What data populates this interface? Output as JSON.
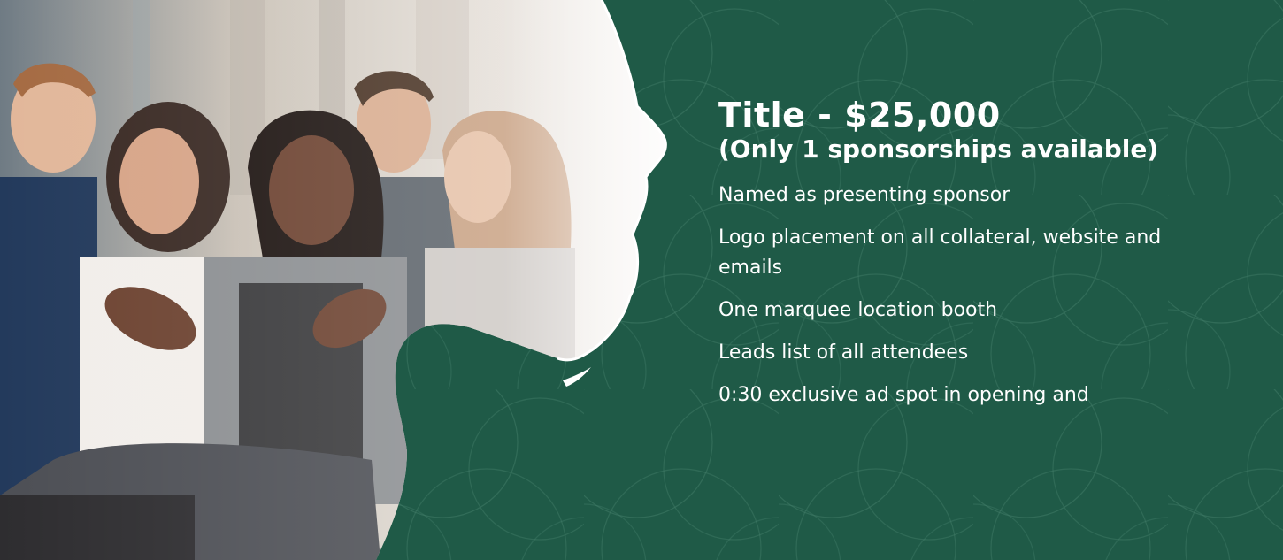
{
  "sponsorship": {
    "title": "Title - $25,000",
    "subtitle": "(Only 1 sponsorships available)",
    "benefits": [
      "Named as presenting sponsor",
      "Logo placement on all collateral, website and emails",
      "One marquee location booth",
      "Leads list of all attendees",
      "0:30 exclusive ad spot in opening and"
    ]
  },
  "colors": {
    "panel_green": "#1f5a47",
    "pattern_line": "#3f7a66",
    "text": "#ffffff"
  },
  "photo": {
    "subject": "audience applauding at conference event"
  }
}
